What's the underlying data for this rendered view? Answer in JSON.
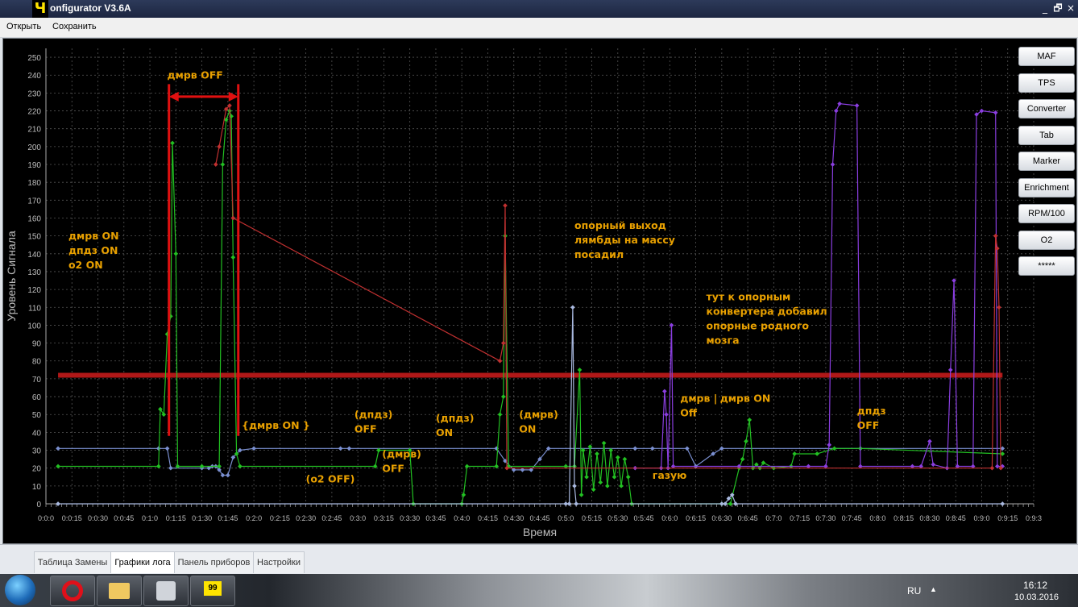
{
  "window": {
    "icon_char": "Ч",
    "title": "onfigurator V3.6A",
    "minimize_glyph": "_",
    "restore_glyph": "🗗",
    "close_glyph": "×"
  },
  "menu": {
    "open": "Открыть",
    "save": "Сохранить"
  },
  "side_buttons": [
    "MAF",
    "TPS",
    "Converter",
    "Tab",
    "Marker",
    "Enrichment",
    "RPM/100",
    "O2",
    "*****"
  ],
  "tabs": [
    {
      "label": "Таблица Замены",
      "active": false
    },
    {
      "label": "Графики лога",
      "active": true
    },
    {
      "label": "Панель приборов",
      "active": false
    },
    {
      "label": "Настройки",
      "active": false
    }
  ],
  "taskbar": {
    "lang": "RU",
    "time": "16:12",
    "date": "10.03.2016",
    "tray_arrow": "▲",
    "app_label": "99"
  },
  "chart_data": {
    "type": "line",
    "ylabel": "Уровень Сигнала",
    "xlabel": "Время",
    "ylim": [
      0,
      255
    ],
    "yticks": [
      0,
      10,
      20,
      30,
      40,
      50,
      60,
      70,
      80,
      90,
      100,
      110,
      120,
      130,
      140,
      150,
      160,
      170,
      180,
      190,
      200,
      210,
      220,
      230,
      240,
      250
    ],
    "xlim": [
      0,
      570
    ],
    "xticks": [
      "0:0:0",
      "0:0:15",
      "0:0:30",
      "0:0:45",
      "0:1:0",
      "0:1:15",
      "0:1:30",
      "0:1:45",
      "0:2:0",
      "0:2:15",
      "0:2:30",
      "0:2:45",
      "0:3:0",
      "0:3:15",
      "0:3:30",
      "0:3:45",
      "0:4:0",
      "0:4:15",
      "0:4:30",
      "0:4:45",
      "0:5:0",
      "0:5:15",
      "0:5:30",
      "0:5:45",
      "0:6:0",
      "0:6:15",
      "0:6:30",
      "0:6:45",
      "0:7:0",
      "0:7:15",
      "0:7:30",
      "0:7:45",
      "0:8:0",
      "0:8:15",
      "0:8:30",
      "0:8:45",
      "0:9:0",
      "0:9:15",
      "0:9:3"
    ],
    "grid": true,
    "colors": {
      "threshold": "#b01818",
      "blue": "#7a8fd0",
      "green": "#22c022",
      "purple": "#8a3ee0",
      "lightblue": "#a9b9e0",
      "red": "#c03030",
      "orange": "#e0a020"
    },
    "threshold": {
      "value": 72,
      "x": [
        7,
        552
      ]
    },
    "series": [
      {
        "color_key": "blue",
        "points": [
          [
            7,
            31
          ],
          [
            65,
            31
          ],
          [
            70,
            31
          ],
          [
            72,
            20
          ],
          [
            90,
            20
          ],
          [
            94,
            20
          ],
          [
            96,
            21
          ],
          [
            98,
            21
          ],
          [
            100,
            19
          ],
          [
            102,
            16
          ],
          [
            105,
            16
          ],
          [
            108,
            26
          ],
          [
            112,
            30
          ],
          [
            120,
            31
          ],
          [
            170,
            31
          ],
          [
            175,
            31
          ],
          [
            260,
            31
          ],
          [
            265,
            24
          ],
          [
            270,
            19
          ],
          [
            275,
            19
          ],
          [
            280,
            19
          ],
          [
            285,
            25
          ],
          [
            290,
            31
          ],
          [
            340,
            31
          ],
          [
            350,
            31
          ],
          [
            370,
            31
          ],
          [
            375,
            21
          ],
          [
            385,
            28
          ],
          [
            390,
            31
          ],
          [
            470,
            31
          ],
          [
            552,
            31
          ]
        ]
      },
      {
        "color_key": "green",
        "points": [
          [
            7,
            21
          ],
          [
            65,
            21
          ],
          [
            66,
            53
          ],
          [
            68,
            50
          ],
          [
            70,
            95
          ],
          [
            72,
            105
          ],
          [
            73,
            202
          ],
          [
            75,
            140
          ],
          [
            76,
            21
          ],
          [
            90,
            21
          ],
          [
            100,
            21
          ],
          [
            102,
            190
          ],
          [
            104,
            215
          ],
          [
            106,
            220
          ],
          [
            107,
            217
          ],
          [
            108,
            138
          ],
          [
            110,
            28
          ],
          [
            112,
            21
          ],
          [
            190,
            21
          ],
          [
            192,
            30
          ],
          [
            210,
            30
          ],
          [
            212,
            0
          ],
          [
            240,
            0
          ],
          [
            241,
            5
          ],
          [
            243,
            21
          ],
          [
            260,
            21
          ],
          [
            262,
            50
          ],
          [
            264,
            60
          ],
          [
            265,
            150
          ],
          [
            267,
            21
          ],
          [
            300,
            21
          ],
          [
            305,
            21
          ],
          [
            308,
            75
          ],
          [
            309,
            5
          ],
          [
            310,
            30
          ],
          [
            312,
            15
          ],
          [
            314,
            32
          ],
          [
            316,
            8
          ],
          [
            318,
            28
          ],
          [
            320,
            12
          ],
          [
            322,
            34
          ],
          [
            324,
            10
          ],
          [
            326,
            30
          ],
          [
            328,
            15
          ],
          [
            330,
            26
          ],
          [
            332,
            10
          ],
          [
            334,
            25
          ],
          [
            336,
            15
          ],
          [
            338,
            0
          ],
          [
            390,
            0
          ],
          [
            395,
            0
          ],
          [
            400,
            20
          ],
          [
            402,
            25
          ],
          [
            404,
            35
          ],
          [
            406,
            47
          ],
          [
            408,
            20
          ],
          [
            410,
            22
          ],
          [
            412,
            20
          ],
          [
            414,
            23
          ],
          [
            420,
            20
          ],
          [
            430,
            21
          ],
          [
            432,
            28
          ],
          [
            445,
            28
          ],
          [
            455,
            31
          ],
          [
            470,
            31
          ],
          [
            552,
            28
          ]
        ]
      },
      {
        "color_key": "purple",
        "points": [
          [
            340,
            20
          ],
          [
            355,
            20
          ],
          [
            357,
            63
          ],
          [
            358,
            50
          ],
          [
            359,
            20
          ],
          [
            361,
            100
          ],
          [
            362,
            21
          ],
          [
            400,
            21
          ],
          [
            440,
            21
          ],
          [
            450,
            21
          ],
          [
            452,
            33
          ],
          [
            454,
            190
          ],
          [
            456,
            220
          ],
          [
            458,
            224
          ],
          [
            468,
            223
          ],
          [
            470,
            21
          ],
          [
            500,
            21
          ],
          [
            505,
            21
          ],
          [
            510,
            35
          ],
          [
            512,
            22
          ],
          [
            520,
            20
          ],
          [
            522,
            75
          ],
          [
            524,
            125
          ],
          [
            526,
            21
          ],
          [
            535,
            21
          ],
          [
            537,
            218
          ],
          [
            540,
            220
          ],
          [
            548,
            219
          ],
          [
            549,
            21
          ],
          [
            552,
            21
          ]
        ]
      },
      {
        "color_key": "lightblue",
        "points": [
          [
            7,
            0
          ],
          [
            300,
            0
          ],
          [
            302,
            0
          ],
          [
            304,
            110
          ],
          [
            305,
            10
          ],
          [
            306,
            0
          ],
          [
            390,
            0
          ],
          [
            392,
            0
          ],
          [
            394,
            3
          ],
          [
            396,
            5
          ],
          [
            398,
            0
          ],
          [
            552,
            0
          ]
        ]
      },
      {
        "color_key": "red",
        "points": [
          [
            98,
            190
          ],
          [
            100,
            200
          ],
          [
            104,
            221
          ],
          [
            106,
            223
          ],
          [
            108,
            160
          ],
          [
            262,
            80
          ],
          [
            264,
            90
          ],
          [
            265,
            167
          ],
          [
            266,
            20
          ],
          [
            546,
            20
          ],
          [
            548,
            150
          ],
          [
            549,
            143
          ],
          [
            550,
            110
          ],
          [
            551,
            20
          ]
        ]
      }
    ],
    "annotations": [
      {
        "lines": [
          "дмрв ON",
          "дпдз ON",
          "о2 ON"
        ],
        "x": 13,
        "y": 148,
        "color": "#e8a000"
      },
      {
        "lines": [
          "дмрв OFF"
        ],
        "x": 70,
        "y": 238,
        "color": "#e8a000"
      },
      {
        "lines": [
          "{дмрв ON }"
        ],
        "x": 113,
        "y": 42,
        "color": "#e8a000"
      },
      {
        "lines": [
          "(дпдз)",
          "OFF"
        ],
        "x": 178,
        "y": 48,
        "color": "#e8a000"
      },
      {
        "lines": [
          "(дмрв)",
          "OFF"
        ],
        "x": 194,
        "y": 26,
        "color": "#e8a000"
      },
      {
        "lines": [
          "(о2 OFF)"
        ],
        "x": 150,
        "y": 12,
        "color": "#e8a000"
      },
      {
        "lines": [
          "(дпдз)",
          "ON"
        ],
        "x": 225,
        "y": 46,
        "color": "#e8a000"
      },
      {
        "lines": [
          "(дмрв)",
          "ON"
        ],
        "x": 273,
        "y": 48,
        "color": "#e8a000"
      },
      {
        "lines": [
          "опорный выход",
          "лямбды на массу",
          "посадил"
        ],
        "x": 305,
        "y": 154,
        "color": "#e8a000"
      },
      {
        "lines": [
          "газую"
        ],
        "x": 350,
        "y": 14,
        "color": "#e8a000"
      },
      {
        "lines": [
          "тут к опорным",
          "конвертера добавил",
          "опорные родного",
          "мозга"
        ],
        "x": 381,
        "y": 114,
        "color": "#e8a000"
      },
      {
        "lines": [
          "дмрв |",
          "Off"
        ],
        "x": 366,
        "y": 57,
        "color": "#e8a000"
      },
      {
        "lines": [
          "дмрв ON"
        ],
        "x": 389,
        "y": 57,
        "color": "#e8a000"
      },
      {
        "lines": [
          "дпдз",
          "OFF"
        ],
        "x": 468,
        "y": 50,
        "color": "#e8a000"
      }
    ],
    "markers": {
      "vertical_lines_x": [
        71,
        111
      ],
      "arrow_y": 228
    }
  }
}
